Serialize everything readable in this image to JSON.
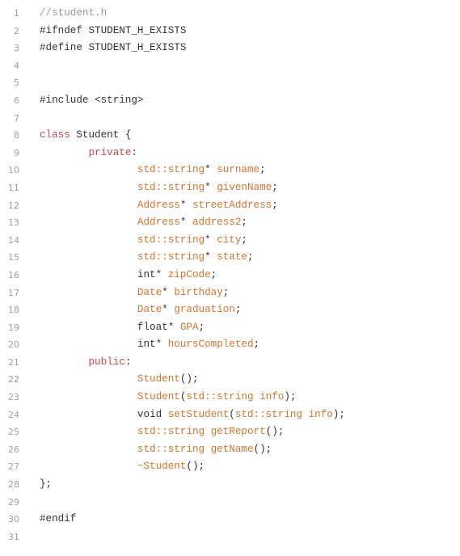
{
  "file": {
    "lines": [
      {
        "n": "1",
        "indent": "",
        "tokens": [
          {
            "t": "//student.h",
            "k": "comment"
          }
        ]
      },
      {
        "n": "2",
        "indent": "",
        "tokens": [
          {
            "t": "#ifndef STUDENT_H_EXISTS",
            "k": "directive"
          }
        ]
      },
      {
        "n": "3",
        "indent": "",
        "tokens": [
          {
            "t": "#define STUDENT_H_EXISTS",
            "k": "directive"
          }
        ]
      },
      {
        "n": "4",
        "indent": "",
        "tokens": []
      },
      {
        "n": "5",
        "indent": "",
        "tokens": []
      },
      {
        "n": "6",
        "indent": "",
        "tokens": [
          {
            "t": "#include <string>",
            "k": "directive"
          }
        ]
      },
      {
        "n": "7",
        "indent": "",
        "tokens": []
      },
      {
        "n": "8",
        "indent": "",
        "tokens": [
          {
            "t": "class",
            "k": "keyword"
          },
          {
            "t": " Student {",
            "k": "plain"
          }
        ]
      },
      {
        "n": "9",
        "indent": "        ",
        "tokens": [
          {
            "t": "private",
            "k": "keyword"
          },
          {
            "t": ":",
            "k": "punc"
          }
        ]
      },
      {
        "n": "10",
        "indent": "                ",
        "tokens": [
          {
            "t": "std::string",
            "k": "type"
          },
          {
            "t": "* ",
            "k": "punc"
          },
          {
            "t": "surname",
            "k": "ident"
          },
          {
            "t": ";",
            "k": "punc"
          }
        ]
      },
      {
        "n": "11",
        "indent": "                ",
        "tokens": [
          {
            "t": "std::string",
            "k": "type"
          },
          {
            "t": "* ",
            "k": "punc"
          },
          {
            "t": "givenName",
            "k": "ident"
          },
          {
            "t": ";",
            "k": "punc"
          }
        ]
      },
      {
        "n": "12",
        "indent": "                ",
        "tokens": [
          {
            "t": "Address",
            "k": "type"
          },
          {
            "t": "* ",
            "k": "punc"
          },
          {
            "t": "streetAddress",
            "k": "ident"
          },
          {
            "t": ";",
            "k": "punc"
          }
        ]
      },
      {
        "n": "13",
        "indent": "                ",
        "tokens": [
          {
            "t": "Address",
            "k": "type"
          },
          {
            "t": "* ",
            "k": "punc"
          },
          {
            "t": "address2",
            "k": "ident"
          },
          {
            "t": ";",
            "k": "punc"
          }
        ]
      },
      {
        "n": "14",
        "indent": "                ",
        "tokens": [
          {
            "t": "std::string",
            "k": "type"
          },
          {
            "t": "* ",
            "k": "punc"
          },
          {
            "t": "city",
            "k": "ident"
          },
          {
            "t": ";",
            "k": "punc"
          }
        ]
      },
      {
        "n": "15",
        "indent": "                ",
        "tokens": [
          {
            "t": "std::string",
            "k": "type"
          },
          {
            "t": "* ",
            "k": "punc"
          },
          {
            "t": "state",
            "k": "ident"
          },
          {
            "t": ";",
            "k": "punc"
          }
        ]
      },
      {
        "n": "16",
        "indent": "                ",
        "tokens": [
          {
            "t": "int",
            "k": "plain"
          },
          {
            "t": "* ",
            "k": "punc"
          },
          {
            "t": "zipCode",
            "k": "ident"
          },
          {
            "t": ";",
            "k": "punc"
          }
        ]
      },
      {
        "n": "17",
        "indent": "                ",
        "tokens": [
          {
            "t": "Date",
            "k": "type"
          },
          {
            "t": "* ",
            "k": "punc"
          },
          {
            "t": "birthday",
            "k": "ident"
          },
          {
            "t": ";",
            "k": "punc"
          }
        ]
      },
      {
        "n": "18",
        "indent": "                ",
        "tokens": [
          {
            "t": "Date",
            "k": "type"
          },
          {
            "t": "* ",
            "k": "punc"
          },
          {
            "t": "graduation",
            "k": "ident"
          },
          {
            "t": ";",
            "k": "punc"
          }
        ]
      },
      {
        "n": "19",
        "indent": "                ",
        "tokens": [
          {
            "t": "float",
            "k": "plain"
          },
          {
            "t": "* ",
            "k": "punc"
          },
          {
            "t": "GPA",
            "k": "ident"
          },
          {
            "t": ";",
            "k": "punc"
          }
        ]
      },
      {
        "n": "20",
        "indent": "                ",
        "tokens": [
          {
            "t": "int",
            "k": "plain"
          },
          {
            "t": "* ",
            "k": "punc"
          },
          {
            "t": "hoursCompleted",
            "k": "ident"
          },
          {
            "t": ";",
            "k": "punc"
          }
        ]
      },
      {
        "n": "21",
        "indent": "        ",
        "tokens": [
          {
            "t": "public",
            "k": "keyword"
          },
          {
            "t": ":",
            "k": "punc"
          }
        ]
      },
      {
        "n": "22",
        "indent": "                ",
        "tokens": [
          {
            "t": "Student",
            "k": "ident"
          },
          {
            "t": "();",
            "k": "punc"
          }
        ]
      },
      {
        "n": "23",
        "indent": "                ",
        "tokens": [
          {
            "t": "Student",
            "k": "ident"
          },
          {
            "t": "(",
            "k": "punc"
          },
          {
            "t": "std::string",
            "k": "type"
          },
          {
            "t": " ",
            "k": "punc"
          },
          {
            "t": "info",
            "k": "ident"
          },
          {
            "t": ");",
            "k": "punc"
          }
        ]
      },
      {
        "n": "24",
        "indent": "                ",
        "tokens": [
          {
            "t": "void",
            "k": "plain"
          },
          {
            "t": " ",
            "k": "punc"
          },
          {
            "t": "setStudent",
            "k": "ident"
          },
          {
            "t": "(",
            "k": "punc"
          },
          {
            "t": "std::string",
            "k": "type"
          },
          {
            "t": " ",
            "k": "punc"
          },
          {
            "t": "info",
            "k": "ident"
          },
          {
            "t": ");",
            "k": "punc"
          }
        ]
      },
      {
        "n": "25",
        "indent": "                ",
        "tokens": [
          {
            "t": "std::string",
            "k": "type"
          },
          {
            "t": " ",
            "k": "punc"
          },
          {
            "t": "getReport",
            "k": "ident"
          },
          {
            "t": "();",
            "k": "punc"
          }
        ]
      },
      {
        "n": "26",
        "indent": "                ",
        "tokens": [
          {
            "t": "std::string",
            "k": "type"
          },
          {
            "t": " ",
            "k": "punc"
          },
          {
            "t": "getName",
            "k": "ident"
          },
          {
            "t": "();",
            "k": "punc"
          }
        ]
      },
      {
        "n": "27",
        "indent": "                ",
        "tokens": [
          {
            "t": "~Student",
            "k": "ident"
          },
          {
            "t": "();",
            "k": "punc"
          }
        ]
      },
      {
        "n": "28",
        "indent": "",
        "tokens": [
          {
            "t": "};",
            "k": "punc"
          }
        ]
      },
      {
        "n": "29",
        "indent": "",
        "tokens": []
      },
      {
        "n": "30",
        "indent": "",
        "tokens": [
          {
            "t": "#endif",
            "k": "directive"
          }
        ]
      },
      {
        "n": "31",
        "indent": "",
        "tokens": []
      }
    ]
  },
  "colors": {
    "background": "#ffffff",
    "line_number": "#a0a0a0",
    "comment": "#999999",
    "keyword": "#c4494a",
    "identifier": "#d6732f",
    "plain": "#333333"
  }
}
